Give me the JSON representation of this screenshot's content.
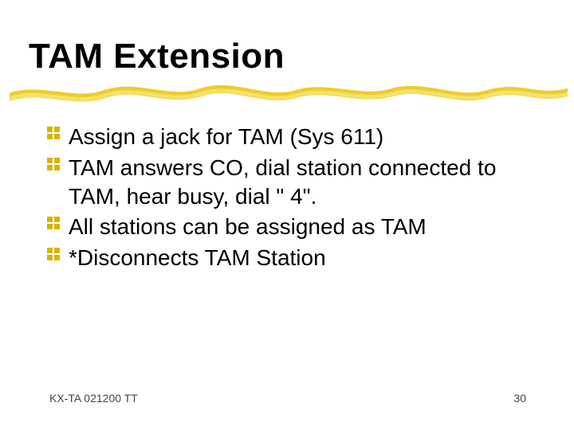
{
  "title": "TAM Extension",
  "bullets": [
    "Assign a jack for TAM (Sys 611)",
    "TAM answers CO, dial station connected to TAM, hear busy, dial \" 4\".",
    "All stations can be assigned as TAM",
    "*Disconnects TAM Station"
  ],
  "footer": {
    "left": "KX-TA 021200 TT",
    "page": "30"
  },
  "colors": {
    "accent": "#eccd2a"
  }
}
